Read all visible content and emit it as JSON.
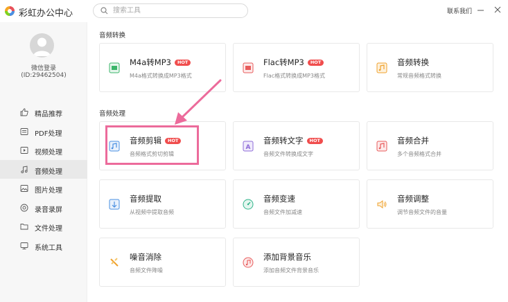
{
  "app": {
    "title": "彩虹办公中心",
    "search_placeholder": "搜索工具",
    "contact": "联系我们",
    "minimize_icon": "minimize-icon",
    "close_icon": "close-icon"
  },
  "user": {
    "login": "微信登录",
    "id": "(ID:29462504)"
  },
  "sidebar": {
    "items": [
      {
        "label": "精品推荐",
        "icon": "thumbs-up-icon"
      },
      {
        "label": "PDF处理",
        "icon": "pdf-icon"
      },
      {
        "label": "视频处理",
        "icon": "video-icon"
      },
      {
        "label": "音频处理",
        "icon": "music-icon",
        "active": true
      },
      {
        "label": "图片处理",
        "icon": "image-icon"
      },
      {
        "label": "录音录屏",
        "icon": "record-icon"
      },
      {
        "label": "文件处理",
        "icon": "folder-icon"
      },
      {
        "label": "系统工具",
        "icon": "system-icon"
      }
    ]
  },
  "sections": {
    "convert_title": "音频转换",
    "process_title": "音频处理"
  },
  "cards": [
    {
      "name": "M4a转MP3",
      "desc": "M4a格式转换成MP3格式",
      "hot": "HOT",
      "color": "#3bb56a"
    },
    {
      "name": "Flac转MP3",
      "desc": "Flac格式转换成MP3格式",
      "hot": "HOT",
      "color": "#e85b5b"
    },
    {
      "name": "音频转换",
      "desc": "常规音频格式转换",
      "hot": "",
      "color": "#f0a12b"
    },
    {
      "name": "音频剪辑",
      "desc": "音频格式剪切剪辑",
      "hot": "HOT",
      "color": "#4a90e2"
    },
    {
      "name": "音频转文字",
      "desc": "音频文件转换成文字",
      "hot": "HOT",
      "color": "#8e6bd8"
    },
    {
      "name": "音频合并",
      "desc": "多个音频格式合并",
      "hot": "",
      "color": "#e85b5b"
    },
    {
      "name": "音频提取",
      "desc": "从视频中提取音频",
      "hot": "",
      "color": "#4a90e2"
    },
    {
      "name": "音频变速",
      "desc": "音频文件加减速",
      "hot": "",
      "color": "#2fb38a"
    },
    {
      "name": "音频调整",
      "desc": "调节音频文件的音量",
      "hot": "",
      "color": "#f0a12b"
    },
    {
      "name": "噪音消除",
      "desc": "音频文件降噪",
      "hot": "",
      "color": "#f0a12b"
    },
    {
      "name": "添加背景音乐",
      "desc": "添加音频文件背景音乐",
      "hot": "",
      "color": "#e85b5b"
    }
  ]
}
